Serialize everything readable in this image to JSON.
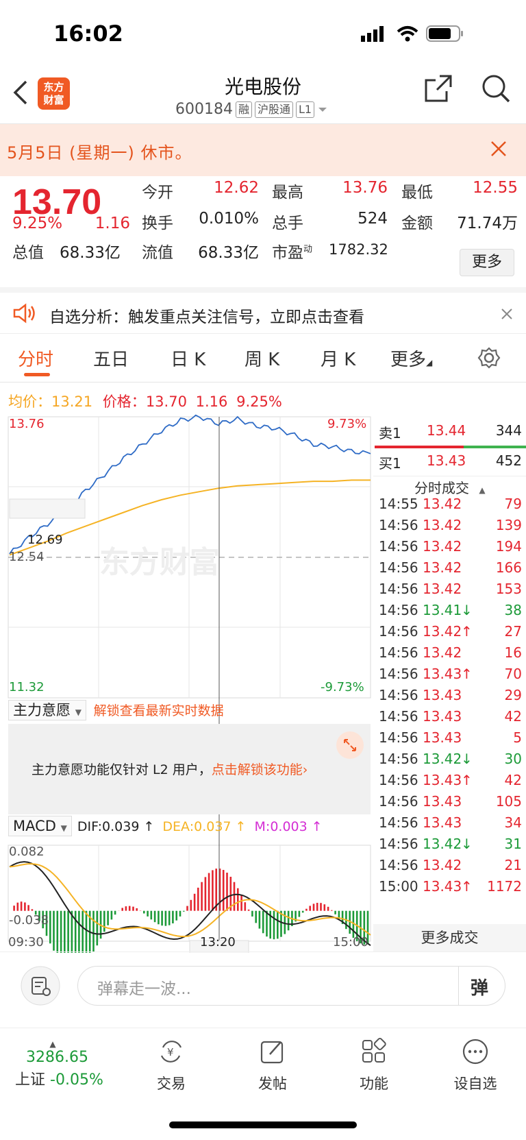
{
  "status_bar": {
    "time": "16:02"
  },
  "header": {
    "logo_line1": "东方",
    "logo_line2": "财富",
    "stock_name": "光电股份",
    "stock_code": "600184",
    "tags": [
      "融",
      "沪股通",
      "L1"
    ]
  },
  "notice": {
    "text": "5月5日 (星期一) 休市。"
  },
  "quote": {
    "price": "13.70",
    "change_pct": "9.25%",
    "change": "1.16",
    "total_value_label": "总值",
    "total_value": "68.33亿",
    "fields": [
      {
        "label": "今开",
        "value": "12.62"
      },
      {
        "label": "最高",
        "value": "13.76"
      },
      {
        "label": "最低",
        "value": "12.55"
      },
      {
        "label": "换手",
        "value": "0.010%"
      },
      {
        "label": "总手",
        "value": "524"
      },
      {
        "label": "金额",
        "value": "71.74万"
      },
      {
        "label": "流值",
        "value": "68.33亿"
      },
      {
        "label": "市盈",
        "value": "1782.32"
      }
    ],
    "pe_superscript": "动",
    "more_label": "更多"
  },
  "banner": {
    "text": "自选分析：触发重点关注信号，立即点击查看"
  },
  "tabs": [
    "分时",
    "五日",
    "日 K",
    "周 K",
    "月 K",
    "更多"
  ],
  "chart_header": {
    "avg_label": "均价：",
    "avg_value": "13.21",
    "price_label": "价格：",
    "price_value": "13.70",
    "change": "1.16",
    "change_pct": "9.25%"
  },
  "chart_data": {
    "type": "line",
    "y_max_label": "13.76",
    "y_min_label": "11.32",
    "pct_max_label": "9.73%",
    "pct_min_label": "-9.73%",
    "prev_close_label": "12.54",
    "cursor_price_label": "12.69",
    "watermark": "东方财富",
    "x_labels": [
      "09:30",
      "13:20",
      "15:00"
    ],
    "ylim": [
      11.32,
      13.76
    ],
    "price_series": [
      12.57,
      12.71,
      12.83,
      12.95,
      13.12,
      13.26,
      13.4,
      13.52,
      13.64,
      13.73,
      13.76,
      13.7,
      13.74,
      13.68,
      13.66,
      13.6,
      13.52,
      13.5,
      13.46,
      13.44
    ],
    "avg_series": [
      12.56,
      12.62,
      12.68,
      12.75,
      12.81,
      12.87,
      12.93,
      12.99,
      13.04,
      13.08,
      13.11,
      13.14,
      13.16,
      13.17,
      13.18,
      13.19,
      13.2,
      13.2,
      13.21,
      13.21
    ]
  },
  "orderbook": {
    "sell": {
      "label": "卖1",
      "price": "13.44",
      "vol": "344"
    },
    "buy": {
      "label": "买1",
      "price": "13.43",
      "vol": "452"
    }
  },
  "ticks_title": "分时成交",
  "ticks": [
    {
      "t": "14:55",
      "p": "13.42",
      "a": "",
      "v": "79",
      "c": "red"
    },
    {
      "t": "14:56",
      "p": "13.42",
      "a": "",
      "v": "139",
      "c": "red"
    },
    {
      "t": "14:56",
      "p": "13.42",
      "a": "",
      "v": "194",
      "c": "red"
    },
    {
      "t": "14:56",
      "p": "13.42",
      "a": "",
      "v": "166",
      "c": "red"
    },
    {
      "t": "14:56",
      "p": "13.42",
      "a": "",
      "v": "153",
      "c": "red"
    },
    {
      "t": "14:56",
      "p": "13.41",
      "a": "↓",
      "v": "38",
      "c": "green"
    },
    {
      "t": "14:56",
      "p": "13.42",
      "a": "↑",
      "v": "27",
      "c": "red"
    },
    {
      "t": "14:56",
      "p": "13.42",
      "a": "",
      "v": "16",
      "c": "red"
    },
    {
      "t": "14:56",
      "p": "13.43",
      "a": "↑",
      "v": "70",
      "c": "red"
    },
    {
      "t": "14:56",
      "p": "13.43",
      "a": "",
      "v": "29",
      "c": "red"
    },
    {
      "t": "14:56",
      "p": "13.43",
      "a": "",
      "v": "42",
      "c": "red"
    },
    {
      "t": "14:56",
      "p": "13.43",
      "a": "",
      "v": "5",
      "c": "red"
    },
    {
      "t": "14:56",
      "p": "13.42",
      "a": "↓",
      "v": "30",
      "c": "green"
    },
    {
      "t": "14:56",
      "p": "13.43",
      "a": "↑",
      "v": "42",
      "c": "red"
    },
    {
      "t": "14:56",
      "p": "13.43",
      "a": "",
      "v": "105",
      "c": "red"
    },
    {
      "t": "14:56",
      "p": "13.43",
      "a": "",
      "v": "34",
      "c": "red"
    },
    {
      "t": "14:56",
      "p": "13.42",
      "a": "↓",
      "v": "31",
      "c": "green"
    },
    {
      "t": "14:56",
      "p": "13.42",
      "a": "",
      "v": "21",
      "c": "red"
    },
    {
      "t": "15:00",
      "p": "13.43",
      "a": "↑",
      "v": "1172",
      "c": "red"
    }
  ],
  "more_ticks": "更多成交",
  "zlyy": {
    "title": "主力意愿",
    "unlock_link": "解锁查看最新实时数据",
    "box_text": "主力意愿功能仅针对 L2 用户，",
    "box_link": "点击解锁该功能"
  },
  "macd": {
    "title": "MACD",
    "dif": "DIF:0.039 ↑",
    "dea": "DEA:0.037 ↑",
    "m": "M:0.003 ↑",
    "max_label": "0.082",
    "min_label": "-0.038",
    "ylim": [
      -0.038,
      0.082
    ]
  },
  "comment": {
    "placeholder": "弹幕走一波...",
    "danmu": "弹"
  },
  "nav": {
    "index_value": "3286.65",
    "index_name": "上证",
    "index_change": "-0.05%",
    "items": [
      "交易",
      "发帖",
      "功能",
      "设自选"
    ]
  },
  "colors": {
    "up": "#e4252f",
    "down": "#1c9a38",
    "brand": "#f05a24",
    "price_line": "#2e6bc6",
    "avg_line": "#f5b324"
  }
}
